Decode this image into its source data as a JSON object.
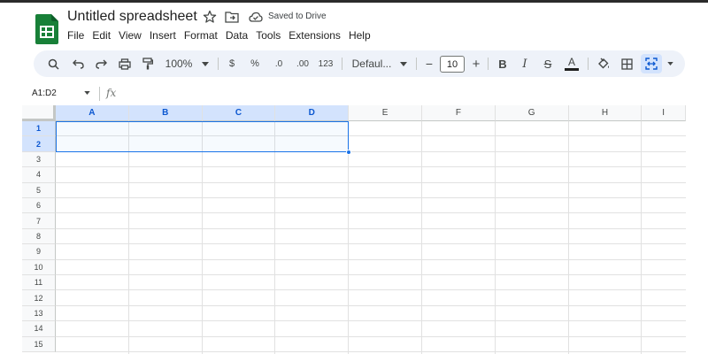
{
  "document": {
    "title": "Untitled spreadsheet",
    "save_status": "Saved to Drive"
  },
  "menu": [
    "File",
    "Edit",
    "View",
    "Insert",
    "Format",
    "Data",
    "Tools",
    "Extensions",
    "Help"
  ],
  "toolbar": {
    "zoom": "100%",
    "currency": "$",
    "percent": "%",
    "decrease_decimal": ".0",
    "increase_decimal": ".00",
    "more_formats": "123",
    "font": "Defaul...",
    "font_size": "10",
    "minus": "−",
    "plus": "+",
    "bold": "B",
    "italic": "I",
    "strike": "S",
    "text_color": "A"
  },
  "formula_bar": {
    "name_box": "A1:D2",
    "fx": "fx",
    "value": ""
  },
  "grid": {
    "columns": [
      "A",
      "B",
      "C",
      "D",
      "E",
      "F",
      "G",
      "H",
      "I"
    ],
    "rows": [
      "1",
      "2",
      "3",
      "4",
      "5",
      "6",
      "7",
      "8",
      "9",
      "10",
      "11",
      "12",
      "13",
      "14",
      "15"
    ],
    "selected_columns": [
      "A",
      "B",
      "C",
      "D"
    ],
    "selected_rows": [
      "1",
      "2"
    ],
    "selection": "A1:D2"
  },
  "colors": {
    "accent": "#1a73e8",
    "header_selected": "#d3e3fd",
    "toolbar_bg": "#eef2f9",
    "sheets_green": "#188038"
  }
}
